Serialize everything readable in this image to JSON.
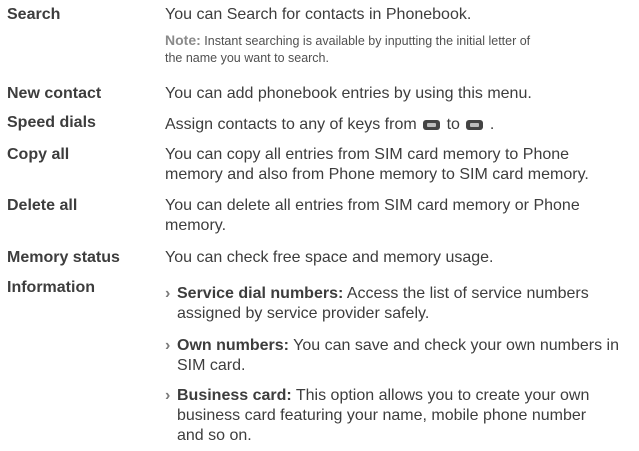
{
  "rows": {
    "search": {
      "term": "Search",
      "desc": "You can Search for contacts in Phonebook.",
      "note_label": "Note:",
      "note_line1": "Instant searching is available by inputting the initial letter of",
      "note_line2": "the name you want to search."
    },
    "new_contact": {
      "term": "New contact",
      "desc": "You can add phonebook entries by using this menu."
    },
    "speed_dials": {
      "term": "Speed dials",
      "desc_prefix": "Assign contacts to any of keys from",
      "desc_mid": "to",
      "desc_suffix": ".",
      "icon_from": "key-2-icon",
      "icon_to": "key-9-icon"
    },
    "copy_all": {
      "term": "Copy all",
      "line1": "You can copy all entries from SIM card memory to Phone",
      "line2": "memory and also from Phone memory to SIM card memory."
    },
    "delete_all": {
      "term": "Delete all",
      "line1": "You can delete all entries from SIM card memory or Phone",
      "line2": "memory."
    },
    "memory_status": {
      "term": "Memory status",
      "desc": "You can check free space and memory usage."
    },
    "information": {
      "term": "Information",
      "items": [
        {
          "title": "Service dial numbers:",
          "text1": "Access the list of service numbers",
          "text2": "assigned by  service provider safely."
        },
        {
          "title": "Own numbers:",
          "text1": "You can save and check your own numbers in",
          "text2": "SIM card."
        },
        {
          "title": "Business card:",
          "text1": "This option allows you to create your own",
          "text2": "business card featuring your name, mobile phone number",
          "text3": "and so on."
        }
      ]
    }
  },
  "bullet_glyph": "›"
}
